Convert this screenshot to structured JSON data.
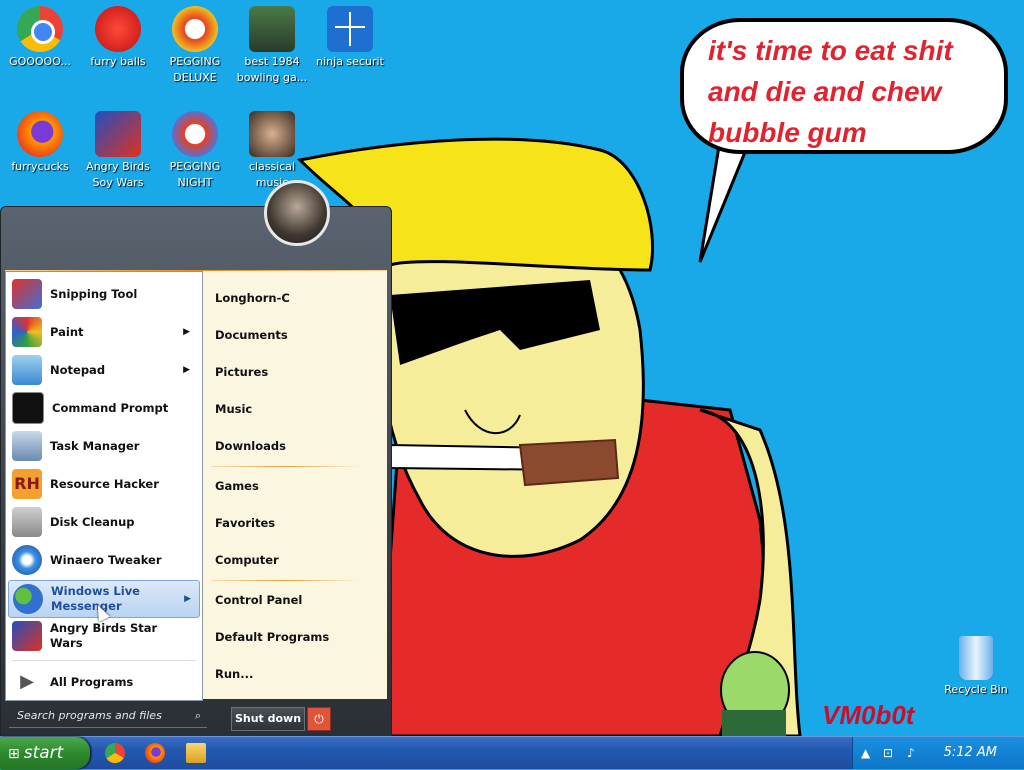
{
  "desktop": {
    "icons": [
      {
        "label": "GOOOOO...",
        "icon": "chrome-icon"
      },
      {
        "label": "furry balls",
        "icon": "furry-balls-icon"
      },
      {
        "label": "PEGGING DELUXE",
        "icon": "pegging-deluxe-icon"
      },
      {
        "label": "best 1984 bowling ga...",
        "icon": "bowling-game-icon"
      },
      {
        "label": "ninja securit",
        "icon": "shield-icon"
      },
      {
        "label": "furrycucks",
        "icon": "firefox-icon"
      },
      {
        "label": "Angry Birds Soy Wars",
        "icon": "angry-birds-star-wars-icon"
      },
      {
        "label": "PEGGING NIGHT",
        "icon": "pegging-night-icon"
      },
      {
        "label": "classical music",
        "icon": "classical-music-icon"
      },
      {
        "label": "Recycle Bin",
        "icon": "recycle-bin-icon"
      }
    ],
    "speech_bubble": "it's time to eat shit and die and chew bubble gum",
    "watermark": "VM0b0t"
  },
  "start_menu": {
    "programs": [
      {
        "label": "Snipping Tool",
        "icon": "scissors-icon",
        "submenu": false
      },
      {
        "label": "Paint",
        "icon": "paint-palette-icon",
        "submenu": true
      },
      {
        "label": "Notepad",
        "icon": "notepad-icon",
        "submenu": true
      },
      {
        "label": "Command Prompt",
        "icon": "terminal-icon",
        "submenu": false
      },
      {
        "label": "Task Manager",
        "icon": "task-manager-icon",
        "submenu": false
      },
      {
        "label": "Resource Hacker",
        "icon": "resource-hacker-icon",
        "submenu": false
      },
      {
        "label": "Disk Cleanup",
        "icon": "disk-cleanup-icon",
        "submenu": false
      },
      {
        "label": "Winaero Tweaker",
        "icon": "winaero-icon",
        "submenu": false
      },
      {
        "label": "Windows Live Messenger",
        "icon": "messenger-icon",
        "submenu": true
      },
      {
        "label": "Angry Birds Star Wars",
        "icon": "angry-birds-star-wars-icon",
        "submenu": false
      }
    ],
    "all_programs": "All Programs",
    "places": [
      "Longhorn-C",
      "Documents",
      "Pictures",
      "Music",
      "Downloads",
      "Games",
      "Favorites",
      "Computer",
      "Control Panel",
      "Default Programs",
      "Run..."
    ],
    "search_placeholder": "Search programs and files",
    "shutdown_label": "Shut down"
  },
  "taskbar": {
    "start_label": "start",
    "clock": "5:12 AM"
  },
  "colors": {
    "desktop_bg": "#19a9e8",
    "bubble_text": "#e0242f",
    "taskbar": "#2458b0",
    "start_button": "#2e8a2e"
  }
}
